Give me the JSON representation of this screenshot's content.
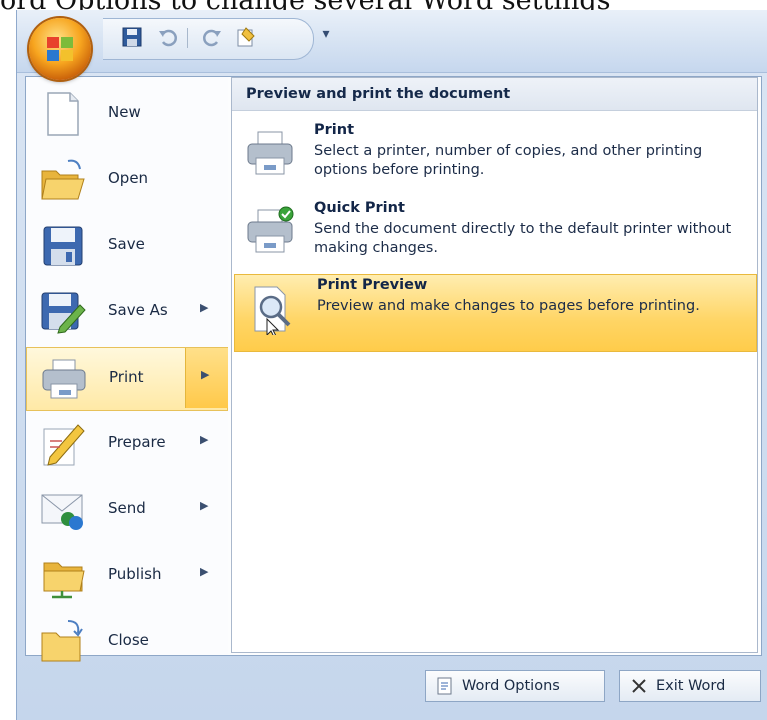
{
  "caption": "ord Options to change several Word settings",
  "menu": {
    "items": [
      {
        "label": "New",
        "has_arrow": false,
        "icon": "new-document-icon"
      },
      {
        "label": "Open",
        "has_arrow": false,
        "icon": "open-folder-icon"
      },
      {
        "label": "Save",
        "has_arrow": false,
        "icon": "save-disk-icon"
      },
      {
        "label": "Save As",
        "has_arrow": true,
        "icon": "save-as-icon"
      },
      {
        "label": "Print",
        "has_arrow": true,
        "icon": "printer-icon",
        "active": true
      },
      {
        "label": "Prepare",
        "has_arrow": true,
        "icon": "prepare-pencil-icon"
      },
      {
        "label": "Send",
        "has_arrow": true,
        "icon": "send-icon"
      },
      {
        "label": "Publish",
        "has_arrow": true,
        "icon": "publish-folder-icon"
      },
      {
        "label": "Close",
        "has_arrow": false,
        "icon": "close-folder-icon"
      }
    ],
    "arrow_glyph": "▶"
  },
  "submenu": {
    "header": "Preview and print the document",
    "options": [
      {
        "title": "Print",
        "desc": "Select a printer, number of copies, and other printing options before printing.",
        "icon": "printer-icon"
      },
      {
        "title": "Quick Print",
        "desc": "Send the document directly to the default printer without making changes.",
        "icon": "quick-print-icon"
      },
      {
        "title": "Print Preview",
        "desc": "Preview and make changes to pages before printing.",
        "icon": "print-preview-icon",
        "highlighted": true
      }
    ]
  },
  "footer": {
    "word_options": "Word Options",
    "exit_word": "Exit Word"
  },
  "colors": {
    "accent_highlight": "#ffd565",
    "menu_border": "#8ea7c7",
    "ribbon_blue": "#c6d7ee"
  }
}
